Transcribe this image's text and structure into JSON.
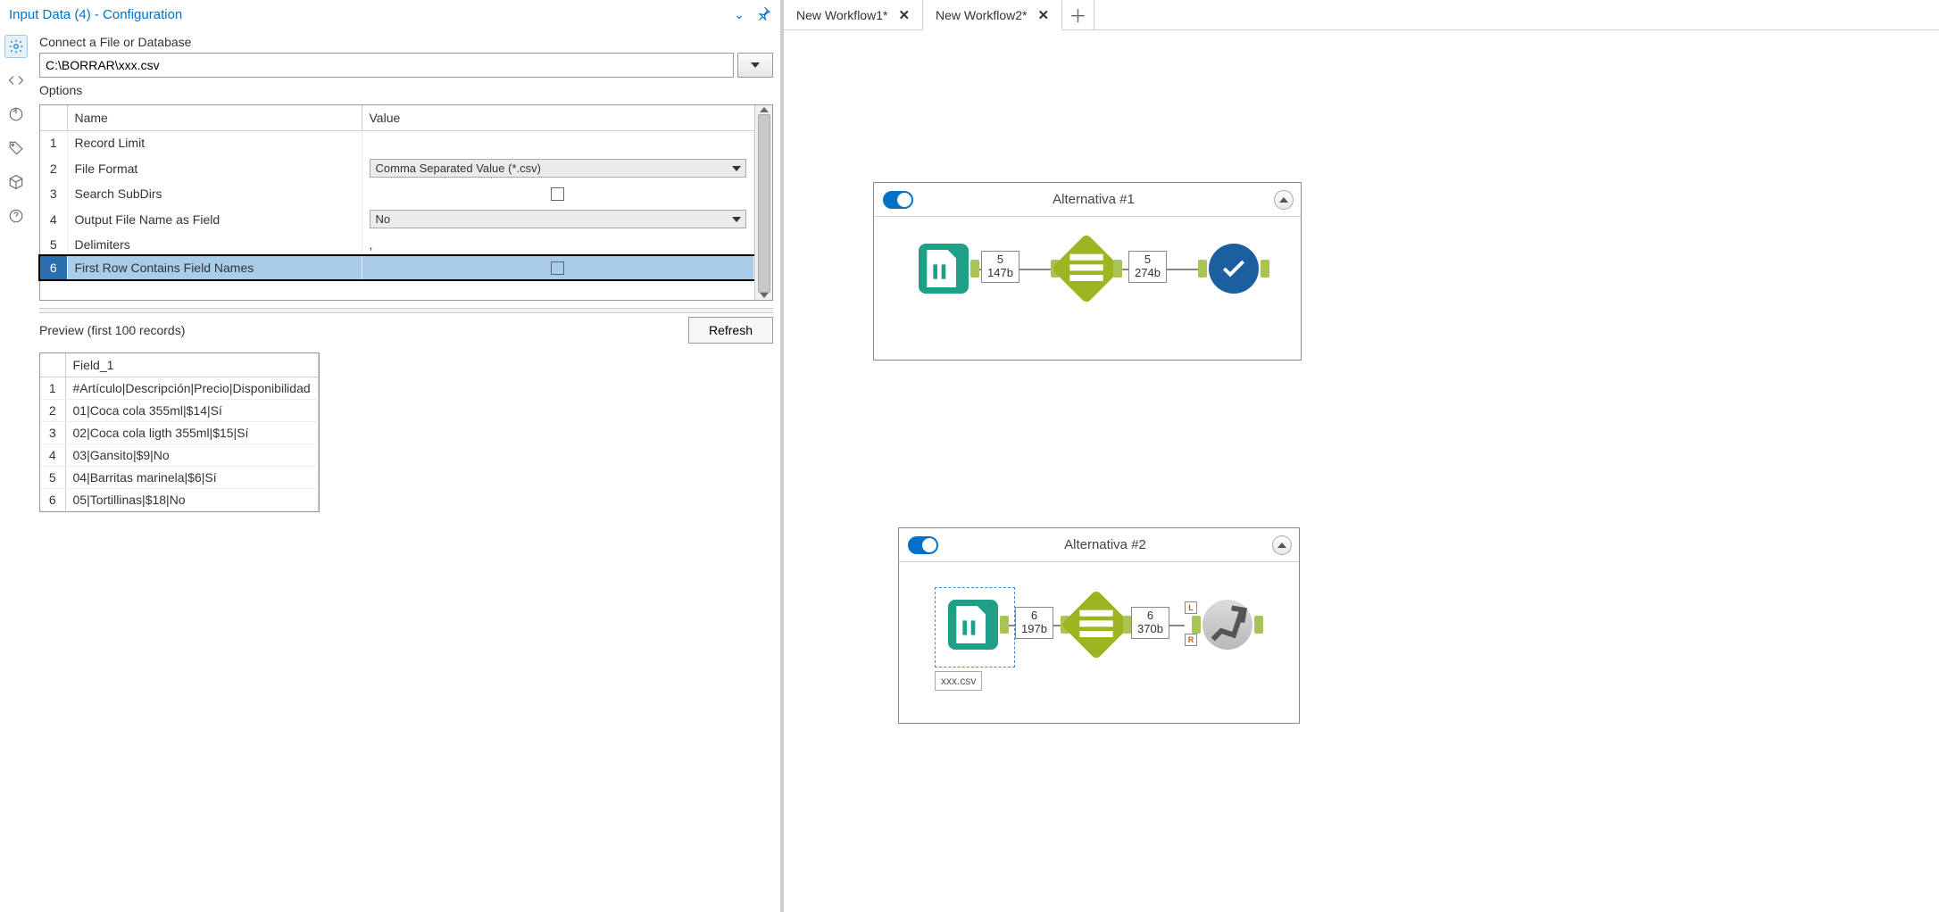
{
  "panel": {
    "title": "Input Data (4) - Configuration",
    "connect_label": "Connect a File or Database",
    "file_path": "C:\\BORRAR\\xxx.csv",
    "options_label": "Options",
    "options_headers": {
      "name": "Name",
      "value": "Value"
    },
    "options_rows": [
      {
        "n": "1",
        "name": "Record Limit",
        "value": ""
      },
      {
        "n": "2",
        "name": "File Format",
        "value": "Comma Separated Value (*.csv)",
        "type": "select"
      },
      {
        "n": "3",
        "name": "Search SubDirs",
        "value": "",
        "type": "check"
      },
      {
        "n": "4",
        "name": "Output File Name as Field",
        "value": "No",
        "type": "select"
      },
      {
        "n": "5",
        "name": "Delimiters",
        "value": ","
      },
      {
        "n": "6",
        "name": "First Row Contains Field Names",
        "value": "",
        "type": "check",
        "selected": true
      }
    ],
    "preview_label": "Preview (first 100 records)",
    "refresh_label": "Refresh",
    "preview_header": "Field_1",
    "preview_rows": [
      {
        "n": "1",
        "v": "#Artículo|Descripción|Precio|Disponibilidad"
      },
      {
        "n": "2",
        "v": "01|Coca cola 355ml|$14|Sí"
      },
      {
        "n": "3",
        "v": "02|Coca cola ligth 355ml|$15|Sí"
      },
      {
        "n": "4",
        "v": "03|Gansito|$9|No"
      },
      {
        "n": "5",
        "v": "04|Barritas marinela|$6|Sí"
      },
      {
        "n": "6",
        "v": "05|Tortillinas|$18|No"
      }
    ]
  },
  "tabs": [
    {
      "label": "New Workflow1*",
      "active": false
    },
    {
      "label": "New Workflow2*",
      "active": true
    }
  ],
  "containers": {
    "alt1": {
      "title": "Alternativa #1",
      "anno1": {
        "count": "5",
        "size": "147b"
      },
      "anno2": {
        "count": "5",
        "size": "274b"
      }
    },
    "alt2": {
      "title": "Alternativa #2",
      "anno1": {
        "count": "6",
        "size": "197b"
      },
      "anno2": {
        "count": "6",
        "size": "370b"
      },
      "file_label": "xxx.csv",
      "badge_L": "L",
      "badge_R": "R"
    }
  }
}
